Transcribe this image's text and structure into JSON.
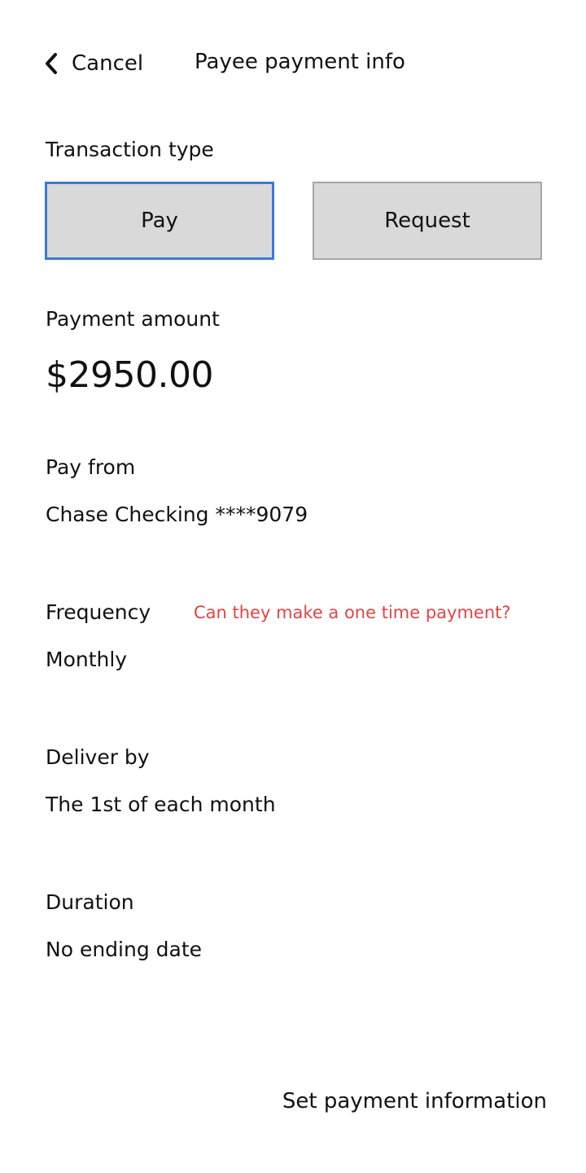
{
  "header": {
    "back_label": "Cancel",
    "title": "Payee payment info"
  },
  "transaction_type": {
    "label": "Transaction type",
    "options": [
      "Pay",
      "Request"
    ],
    "selected": "Pay"
  },
  "payment_amount": {
    "label": "Payment amount",
    "value": "$2950.00"
  },
  "pay_from": {
    "label": "Pay from",
    "value": "Chase Checking ****9079"
  },
  "frequency": {
    "label": "Frequency",
    "value": "Monthly",
    "note": "Can they make a one time payment?"
  },
  "deliver_by": {
    "label": "Deliver by",
    "value": "The 1st of each month"
  },
  "duration": {
    "label": "Duration",
    "value": "No ending date"
  },
  "footer": {
    "cta_label": "Set payment information"
  },
  "colors": {
    "accent": "#3c78d8",
    "note": "#e04646",
    "button_bg": "#d9d9d9"
  },
  "icons": {
    "back": "chevron-left-icon"
  }
}
